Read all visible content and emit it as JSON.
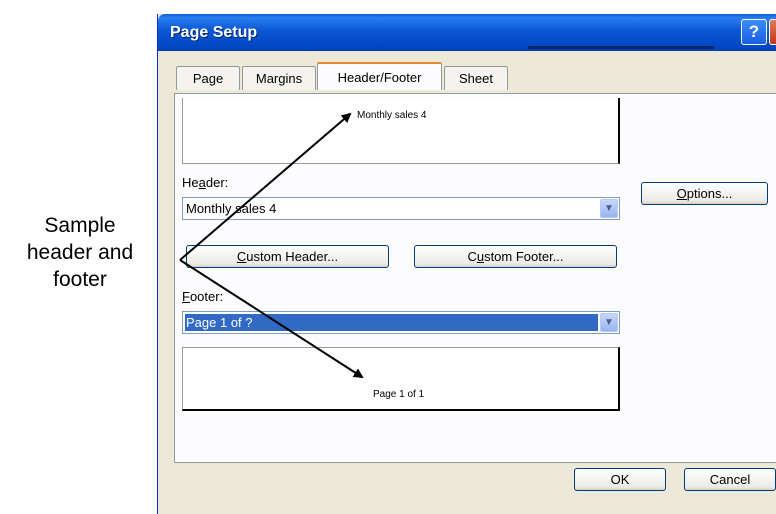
{
  "callout": {
    "line1": "Sample",
    "line2": "header and",
    "line3": "footer"
  },
  "dialog": {
    "title": "Page Setup",
    "help_glyph": "?",
    "close_glyph": "✕",
    "tabs": [
      {
        "label": "Page"
      },
      {
        "label": "Margins"
      },
      {
        "label": "Header/Footer"
      },
      {
        "label": "Sheet"
      }
    ],
    "active_tab": "Header/Footer",
    "header_preview_text": "Monthly sales 4",
    "header_label": {
      "pre": "He",
      "accel": "a",
      "post": "der:"
    },
    "header_value": "Monthly sales 4",
    "custom_header_button": {
      "accel": "C",
      "post": "ustom Header..."
    },
    "custom_footer_button": {
      "pre": "C",
      "accel": "u",
      "post": "stom Footer..."
    },
    "footer_label": {
      "accel": "F",
      "post": "ooter:"
    },
    "footer_value": "Page 1 of ?",
    "footer_preview_text": "Page 1 of 1",
    "options_button": {
      "accel": "O",
      "post": "ptions..."
    },
    "ok_label": "OK",
    "cancel_label": "Cancel",
    "dropdown_icon": "chevron-down-icon"
  },
  "colors": {
    "titlebar": "#0a57d4",
    "selection": "#316ac5",
    "active_tab_accent": "#e68b2c",
    "dialog_bg": "#ece9d8"
  }
}
